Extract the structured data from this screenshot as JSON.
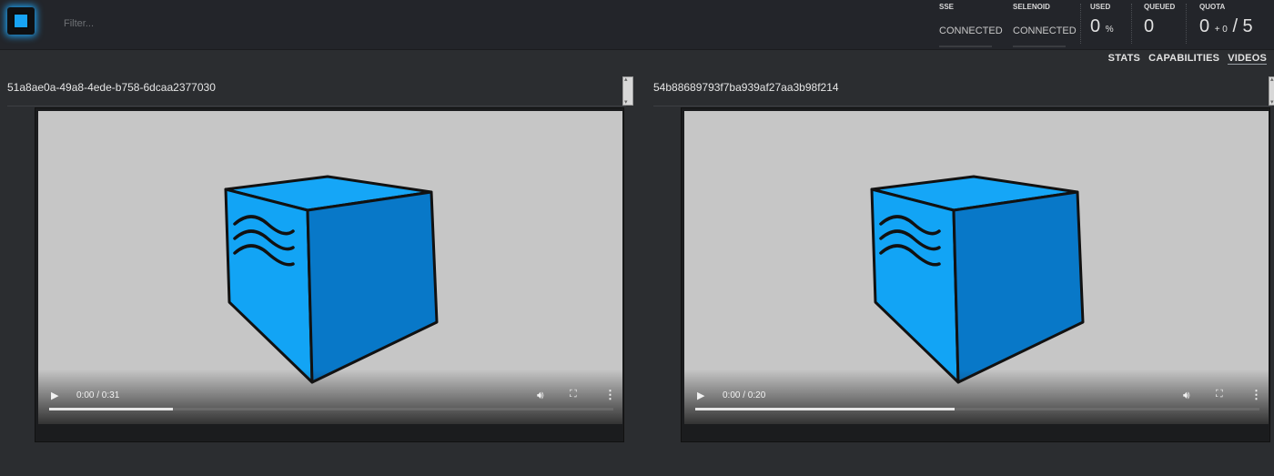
{
  "header": {
    "filter_placeholder": "Filter...",
    "stats": {
      "sse": {
        "label": "SSE",
        "value": "CONNECTED"
      },
      "selenoid": {
        "label": "SELENOID",
        "value": "CONNECTED"
      },
      "used": {
        "label": "USED",
        "value": "0",
        "unit": "%"
      },
      "queued": {
        "label": "QUEUED",
        "value": "0"
      },
      "quota": {
        "label": "QUOTA",
        "value": "0",
        "plus": "+ 0",
        "slash": "/ 5"
      }
    }
  },
  "tabs": [
    {
      "label": "STATS",
      "active": false
    },
    {
      "label": "CAPABILITIES",
      "active": false
    },
    {
      "label": "VIDEOS",
      "active": true
    }
  ],
  "videos": [
    {
      "id": "51a8ae0a-49a8-4ede-b758-6dcaa2377030",
      "time": "0:00 / 0:31",
      "progress": 0.22
    },
    {
      "id": "54b88689793f7ba939af27aa3b98f214",
      "time": "0:00 / 0:20",
      "progress": 0.46
    }
  ],
  "colors": {
    "accent": "#17a3f5",
    "cube_front": "#12a4f5",
    "cube_side": "#0878c8",
    "cube_top": "#15a6f7",
    "video_bg": "#c6c6c6"
  }
}
